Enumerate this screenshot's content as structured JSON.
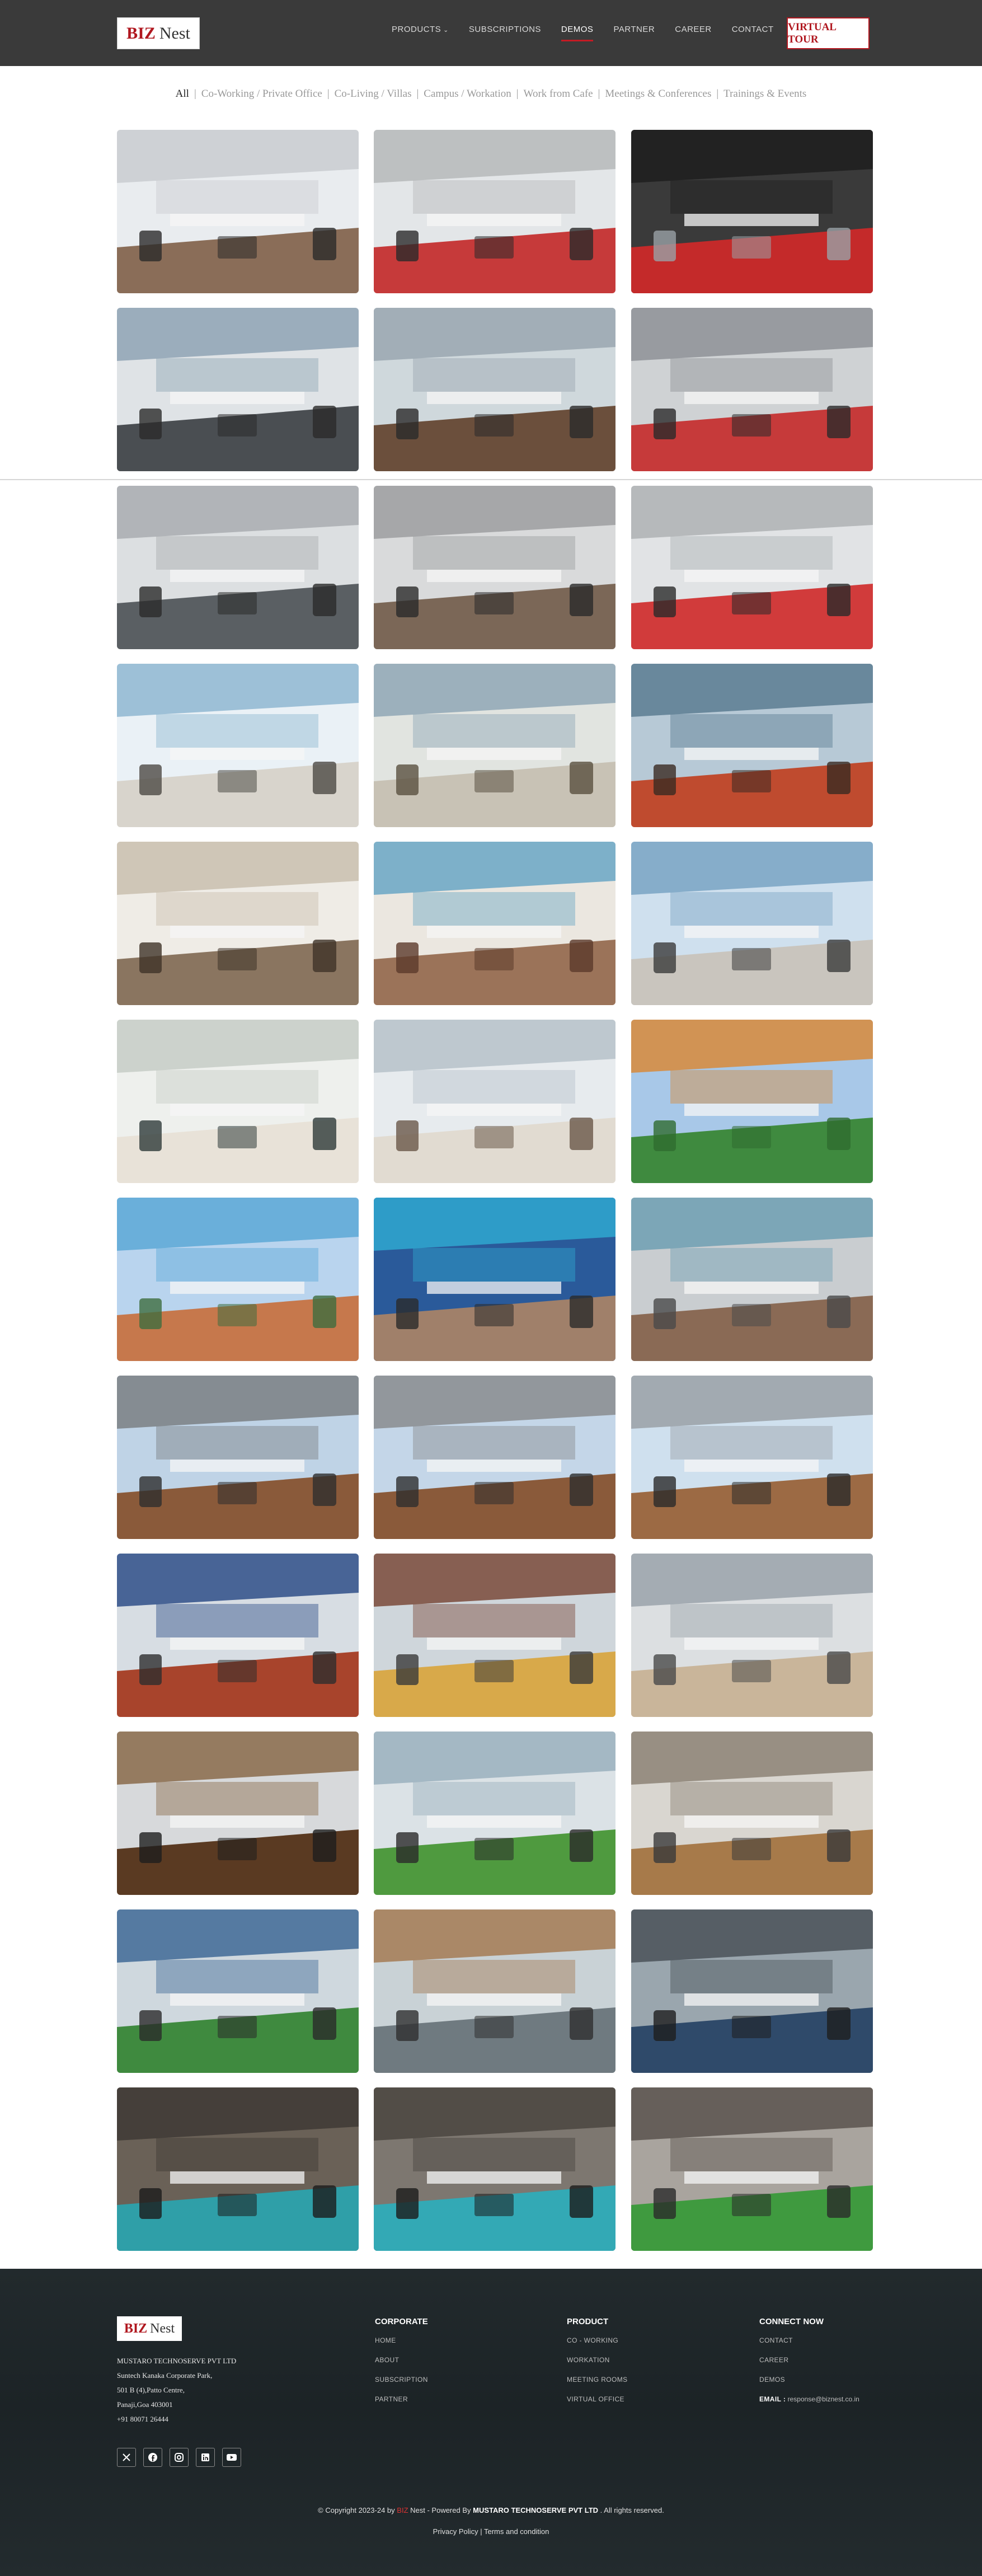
{
  "header": {
    "logo": {
      "biz": "BIZ",
      "nest": "Nest"
    },
    "nav": [
      {
        "label": "PRODUCTS",
        "has_caret": true,
        "active": false
      },
      {
        "label": "SUBSCRIPTIONS",
        "active": false
      },
      {
        "label": "DEMOS",
        "active": true
      },
      {
        "label": "PARTNER",
        "active": false
      },
      {
        "label": "CAREER",
        "active": false
      },
      {
        "label": "CONTACT",
        "active": false
      }
    ],
    "cta_label": "VIRTUAL TOUR",
    "brand_color": "#b0171f"
  },
  "filters": [
    {
      "label": "All",
      "active": true
    },
    {
      "label": "Co-Working / Private Office"
    },
    {
      "label": "Co-Living / Villas"
    },
    {
      "label": "Campus / Workation"
    },
    {
      "label": "Work from Cafe"
    },
    {
      "label": "Meetings & Conferences"
    },
    {
      "label": "Trainings & Events"
    }
  ],
  "gallery": [
    "office-workstations",
    "office-workstations-red-carpet",
    "office-dark-red-lines",
    "london-meeting-room",
    "glass-cabin-office",
    "long-office-red-aisle",
    "office-long-benches",
    "office-benches-grey",
    "office-red-aisle-rows",
    "villa-sea-view-living",
    "sea-view-bedroom-window",
    "balcony-lounge-chairs",
    "villa-bedroom-beige",
    "bedroom-sea-view",
    "balcony-dining-sea",
    "white-bedroom-plants",
    "grey-bedroom-bench",
    "goan-cottage-garden",
    "villa-pool-day",
    "villa-pool-dusk",
    "curved-pool-terrace",
    "courtyard-cafe-stone",
    "courtyard-cafe-lamps",
    "courtyard-cafe-bunting",
    "red-staircase-hall",
    "colorful-lounge",
    "lounge-armchairs",
    "conference-wood-table",
    "conference-green-sill",
    "conference-stone-wall",
    "meeting-room-blue-carpet",
    "glass-lounge-room",
    "meeting-room-glass",
    "training-hall-lights",
    "training-hall-teal-chairs",
    "event-stage-turf"
  ],
  "footer": {
    "logo": {
      "biz": "BIZ",
      "nest": "Nest"
    },
    "company_lines": [
      "MUSTARO TECHNOSERVE PVT LTD",
      "Suntech Kanaka Corporate Park,",
      "501 B (4),Patto Centre,",
      "Panaji,Goa 403001",
      "+91 80071 26444"
    ],
    "socials": [
      "x-icon",
      "facebook-icon",
      "instagram-icon",
      "linkedin-icon",
      "youtube-icon"
    ],
    "columns": [
      {
        "title": "CORPORATE",
        "links": [
          "HOME",
          "ABOUT",
          "SUBSCRIPTION",
          "PARTNER"
        ]
      },
      {
        "title": "PRODUCT",
        "links": [
          "CO - WORKING",
          "WORKATION",
          "MEETING ROOMS",
          "VIRTUAL OFFICE"
        ]
      },
      {
        "title": "CONNECT NOW",
        "links": [
          "CONTACT",
          "CAREER",
          "DEMOS"
        ],
        "email_label": "EMAIL :",
        "email": "response@biznest.co.in"
      }
    ],
    "copyright": {
      "prefix": "© Copyright 2023-24 by",
      "biz": "BIZ",
      "nest": " Nest",
      "middle": " - Powered By",
      "company": "MUSTARO TECHNOSERVE PVT LTD",
      "suffix": " . All rights reserved."
    },
    "legal": {
      "privacy": "Privacy Policy",
      "sep": "|",
      "terms": "Terms and condition"
    }
  }
}
